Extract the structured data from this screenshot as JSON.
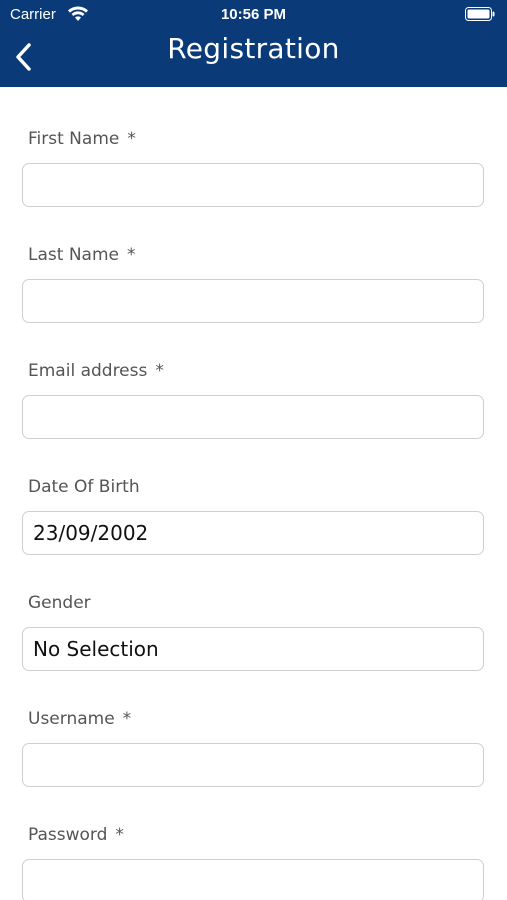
{
  "status_bar": {
    "carrier": "Carrier",
    "time": "10:56 PM",
    "wifi_icon": "wifi-icon",
    "battery_icon": "battery-icon"
  },
  "header": {
    "title": "Registration",
    "back_icon": "chevron-left-icon",
    "background_color": "#0a3a78"
  },
  "form": {
    "first_name": {
      "label": "First Name",
      "required": "*",
      "value": ""
    },
    "last_name": {
      "label": "Last Name",
      "required": "*",
      "value": ""
    },
    "email": {
      "label": "Email address",
      "required": "*",
      "value": ""
    },
    "date_of_birth": {
      "label": "Date Of Birth",
      "value": "23/09/2002"
    },
    "gender": {
      "label": "Gender",
      "value": "No Selection"
    },
    "username": {
      "label": "Username",
      "required": "*",
      "value": ""
    },
    "password": {
      "label": "Password",
      "required": "*",
      "value": ""
    }
  }
}
